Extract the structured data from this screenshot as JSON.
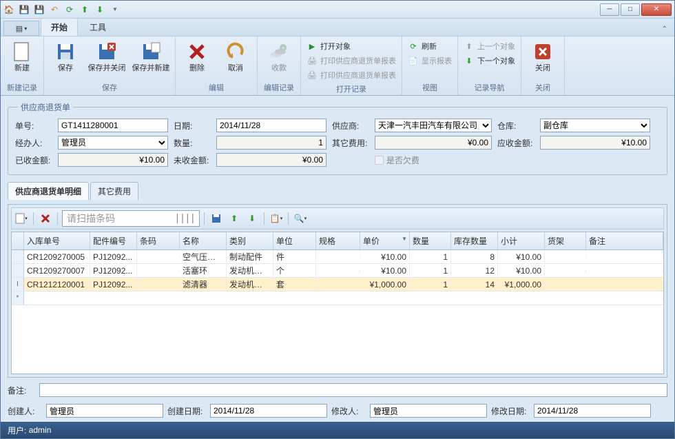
{
  "tabs": {
    "start": "开始",
    "tools": "工具"
  },
  "ribbon": {
    "new": "新建",
    "save": "保存",
    "save_close": "保存并关闭",
    "save_new": "保存并新建",
    "delete": "删除",
    "cancel": "取消",
    "receive": "收款",
    "open_obj": "打开对象",
    "print_return": "打印供应商退货单报表",
    "print_return2": "打印供应商退货单报表",
    "refresh": "刷新",
    "show_report": "显示报表",
    "prev": "上一个对象",
    "next": "下一个对象",
    "close": "关闭",
    "grp_new": "新建记录",
    "grp_save": "保存",
    "grp_edit": "编辑",
    "grp_editrec": "编辑记录",
    "grp_openrec": "打开记录",
    "grp_view": "视图",
    "grp_nav": "记录导航",
    "grp_close": "关闭"
  },
  "form": {
    "legend": "供应商退货单",
    "l_danhao": "单号:",
    "v_danhao": "GT1411280001",
    "l_riqi": "日期:",
    "v_riqi": "2014/11/28",
    "l_gys": "供应商:",
    "v_gys": "天津一汽丰田汽车有限公司",
    "l_cangku": "仓库:",
    "v_cangku": "副仓库",
    "l_jbr": "经办人:",
    "v_jbr": "管理员",
    "l_shuliang": "数量:",
    "v_shuliang": "1",
    "l_qtfy": "其它费用:",
    "v_qtfy": "¥0.00",
    "l_ysje": "应收金额:",
    "v_ysje": "¥10.00",
    "l_yshje": "已收金额:",
    "v_yshje": "¥10.00",
    "l_wsje": "未收金额:",
    "v_wsje": "¥0.00",
    "l_qianfei": "是否欠费"
  },
  "detail_tabs": {
    "mingxi": "供应商退货单明细",
    "qita": "其它费用"
  },
  "barcode_placeholder": "请扫描条码",
  "grid": {
    "headers": {
      "ruku": "入库单号",
      "peijian": "配件编号",
      "tiaoma": "条码",
      "mingcheng": "名称",
      "leibie": "类别",
      "danwei": "单位",
      "guige": "规格",
      "danjia": "单价",
      "shuliang": "数量",
      "kucun": "库存数量",
      "xiaoji": "小计",
      "huojia": "货架",
      "beizhu": "备注"
    },
    "rows": [
      {
        "ruku": "CR1209270005",
        "peijian": "PJ12092...",
        "tiaoma": "",
        "mingcheng": "空气压缩机",
        "leibie": "制动配件",
        "danwei": "件",
        "guige": "",
        "danjia": "¥10.00",
        "shuliang": "1",
        "kucun": "8",
        "xiaoji": "¥10.00",
        "huojia": "",
        "beizhu": ""
      },
      {
        "ruku": "CR1209270007",
        "peijian": "PJ12092...",
        "tiaoma": "",
        "mingcheng": "活塞环",
        "leibie": "发动机配件",
        "danwei": "个",
        "guige": "",
        "danjia": "¥10.00",
        "shuliang": "1",
        "kucun": "12",
        "xiaoji": "¥10.00",
        "huojia": "",
        "beizhu": ""
      },
      {
        "ruku": "CR1212120001",
        "peijian": "PJ12092...",
        "tiaoma": "",
        "mingcheng": "滤清器",
        "leibie": "发动机配件",
        "danwei": "套",
        "guige": "",
        "danjia": "¥1,000.00",
        "shuliang": "1",
        "kucun": "14",
        "xiaoji": "¥1,000.00",
        "huojia": "",
        "beizhu": ""
      }
    ]
  },
  "remark": {
    "label": "备注:"
  },
  "footer": {
    "l_cjr": "创建人:",
    "v_cjr": "管理员",
    "l_cjrq": "创建日期:",
    "v_cjrq": "2014/11/28",
    "l_xgr": "修改人:",
    "v_xgr": "管理员",
    "l_xgrq": "修改日期:",
    "v_xgrq": "2014/11/28"
  },
  "statusbar": {
    "user_label": "用户:",
    "user": "admin"
  }
}
